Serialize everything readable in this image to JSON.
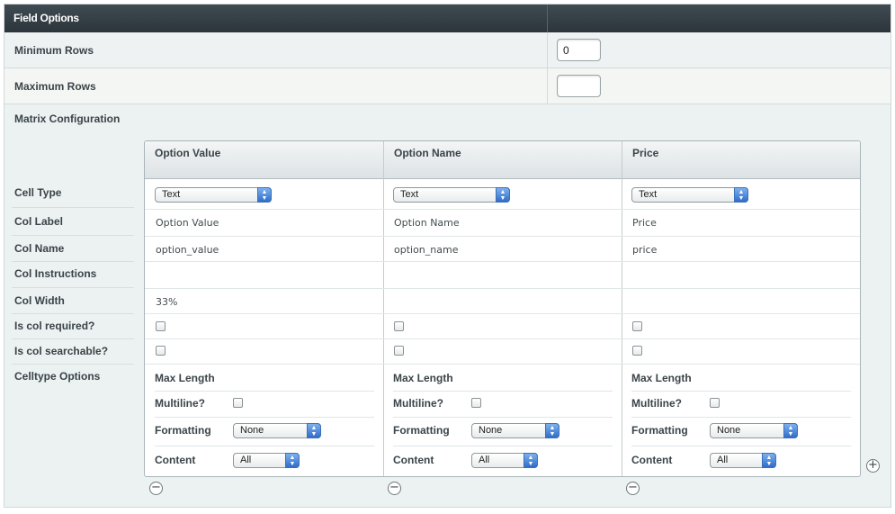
{
  "header": {
    "title": "Field Options"
  },
  "min_rows": {
    "label": "Minimum Rows",
    "value": "0"
  },
  "max_rows": {
    "label": "Maximum Rows",
    "value": ""
  },
  "matrix": {
    "title": "Matrix Configuration",
    "row_labels": {
      "cell_type": "Cell Type",
      "col_label": "Col Label",
      "col_name": "Col Name",
      "col_instructions": "Col Instructions",
      "col_width": "Col Width",
      "required": "Is col required?",
      "searchable": "Is col searchable?",
      "celltype_options": "Celltype Options"
    },
    "option_labels": {
      "max_length": "Max Length",
      "multiline": "Multiline?",
      "formatting": "Formatting",
      "content": "Content"
    },
    "columns": [
      {
        "header": "Option Value",
        "cell_type": "Text",
        "col_label": "Option Value",
        "col_name": "option_value",
        "col_instructions": "",
        "col_width": "33%",
        "required": false,
        "searchable": false,
        "multiline": false,
        "formatting": "None",
        "content": "All"
      },
      {
        "header": "Option Name",
        "cell_type": "Text",
        "col_label": "Option Name",
        "col_name": "option_name",
        "col_instructions": "",
        "col_width": "",
        "required": false,
        "searchable": false,
        "multiline": false,
        "formatting": "None",
        "content": "All"
      },
      {
        "header": "Price",
        "cell_type": "Text",
        "col_label": "Price",
        "col_name": "price",
        "col_instructions": "",
        "col_width": "",
        "required": false,
        "searchable": false,
        "multiline": false,
        "formatting": "None",
        "content": "All"
      }
    ],
    "add_col_icon": "plus-circle-icon",
    "remove_col_icon": "minus-circle-icon",
    "select_arrow_icon": "updown-arrows-icon"
  }
}
